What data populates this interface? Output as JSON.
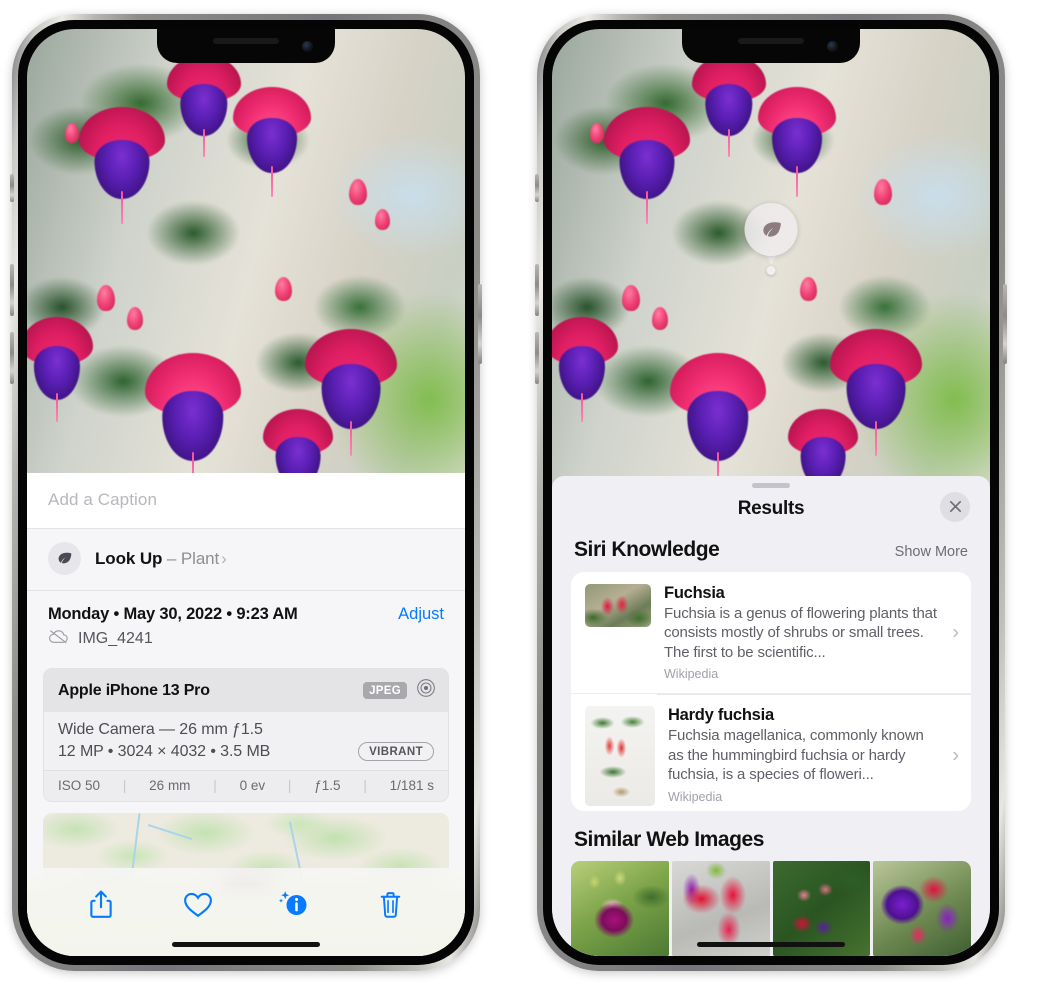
{
  "left_phone": {
    "photo": {
      "alt": "Fuchsia flowers hanging basket"
    },
    "caption_field": {
      "placeholder": "Add a Caption",
      "value": ""
    },
    "look_up": {
      "icon": "leaf-icon",
      "label": "Look Up",
      "dash": "–",
      "subject": "Plant",
      "chevron": "›"
    },
    "meta": {
      "date": "Monday • May 30, 2022 • 9:23 AM",
      "adjust_label": "Adjust",
      "cloud_icon": "icloud-slash-icon",
      "filename": "IMG_4241"
    },
    "camera_card": {
      "device": "Apple iPhone 13 Pro",
      "format_tag": "JPEG",
      "aperture_icon": "aperture-icon",
      "lens_line": "Wide Camera — 26 mm ƒ1.5",
      "resolution_line": "12 MP • 3024 × 4032 • 3.5 MB",
      "style_tag": "VIBRANT",
      "exif": [
        "ISO 50",
        "26 mm",
        "0 ev",
        "ƒ1.5",
        "1/181 s"
      ]
    },
    "toolbar": [
      {
        "name": "share-button",
        "icon": "share-icon"
      },
      {
        "name": "favorite-button",
        "icon": "heart-icon"
      },
      {
        "name": "info-button",
        "icon": "info-sparkle-icon"
      },
      {
        "name": "delete-button",
        "icon": "trash-icon"
      }
    ]
  },
  "right_phone": {
    "visual_look_up_badge": {
      "icon": "leaf-icon"
    },
    "sheet": {
      "title": "Results",
      "close_icon": "close-icon",
      "siri_knowledge": {
        "heading": "Siri Knowledge",
        "action": "Show More",
        "items": [
          {
            "title": "Fuchsia",
            "description": "Fuchsia is a genus of flowering plants that consists mostly of shrubs or small trees. The first to be scientific...",
            "source": "Wikipedia",
            "chevron": "›"
          },
          {
            "title": "Hardy fuchsia",
            "description": "Fuchsia magellanica, commonly known as the hummingbird fuchsia or hardy fuchsia, is a species of floweri...",
            "source": "Wikipedia",
            "chevron": "›"
          }
        ]
      },
      "similar_web_images": {
        "heading": "Similar Web Images",
        "items": [
          "fuchsia-pink-white",
          "fuchsia-red-closeup",
          "fuchsia-bush-buds",
          "fuchsia-purple-red"
        ]
      }
    }
  },
  "colors": {
    "accent_blue": "#067bff",
    "sheet_bg": "#f0eff4",
    "card_bg": "#ffffff",
    "secondary_text": "#8e8e93"
  }
}
